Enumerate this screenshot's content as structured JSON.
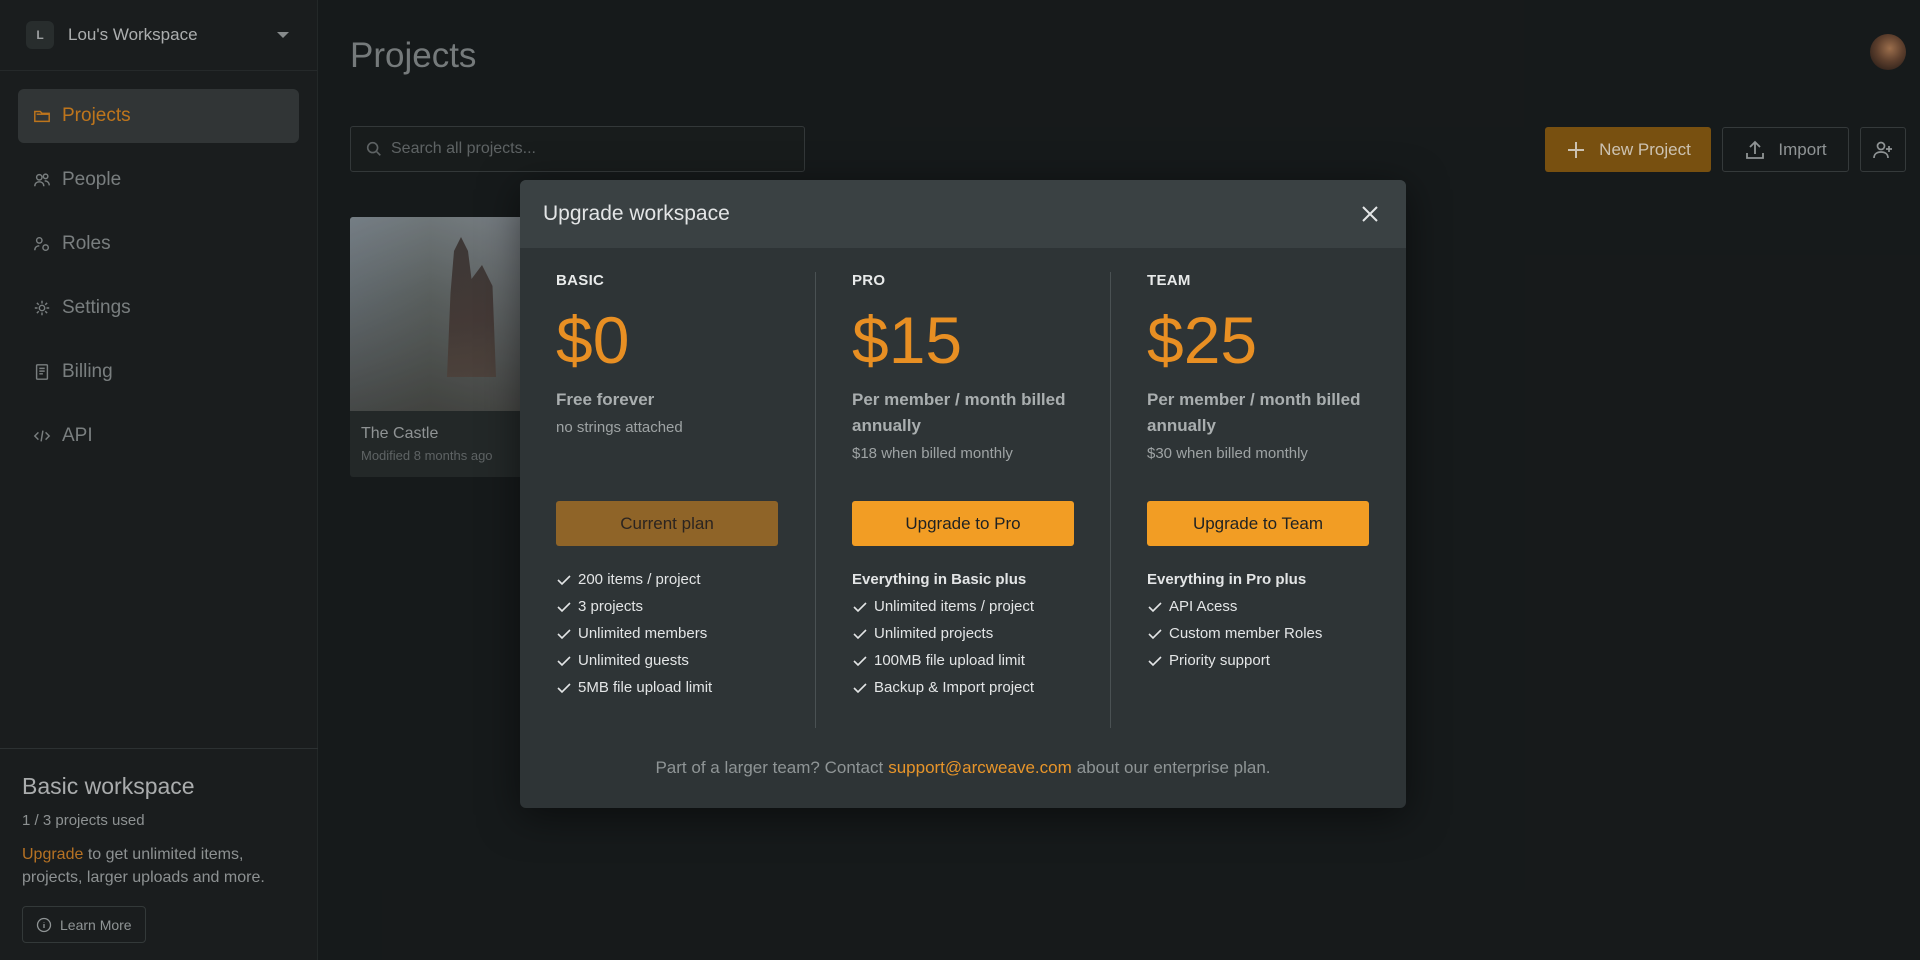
{
  "sidebar": {
    "workspace": {
      "initial": "L",
      "name": "Lou's Workspace"
    },
    "items": [
      {
        "label": "Projects",
        "icon": "folder-icon",
        "active": true
      },
      {
        "label": "People",
        "icon": "people-icon"
      },
      {
        "label": "Roles",
        "icon": "role-icon"
      },
      {
        "label": "Settings",
        "icon": "gear-icon"
      },
      {
        "label": "Billing",
        "icon": "receipt-icon"
      },
      {
        "label": "API",
        "icon": "code-icon"
      }
    ],
    "footer": {
      "title": "Basic workspace",
      "usage": "1 / 3 projects used",
      "upgrade_link": "Upgrade",
      "upgrade_text": " to get unlimited items, projects, larger uploads and more.",
      "learn_more": "Learn More"
    }
  },
  "main": {
    "title": "Projects",
    "search_placeholder": "Search all projects...",
    "new_project": "New Project",
    "import": "Import",
    "projects": [
      {
        "name": "The Castle",
        "modified": "Modified 8 months ago"
      }
    ]
  },
  "modal": {
    "title": "Upgrade workspace",
    "plans": [
      {
        "tier": "BASIC",
        "price": "$0",
        "desc": "Free forever",
        "sub": "no strings attached",
        "button": "Current plan",
        "features": [
          "200 items / project",
          "3 projects",
          "Unlimited members",
          "Unlimited guests",
          "5MB file upload limit"
        ]
      },
      {
        "tier": "PRO",
        "price": "$15",
        "desc": "Per member / month billed annually",
        "sub": "$18 when billed monthly",
        "button": "Upgrade to Pro",
        "features_head": "Everything in Basic plus",
        "features": [
          "Unlimited items / project",
          "Unlimited projects",
          "100MB file upload limit",
          "Backup & Import project"
        ]
      },
      {
        "tier": "TEAM",
        "price": "$25",
        "desc": "Per member / month billed annually",
        "sub": "$30 when billed monthly",
        "button": "Upgrade to Team",
        "features_head": "Everything in Pro plus",
        "features": [
          "API Acess",
          "Custom member Roles",
          "Priority support"
        ]
      }
    ],
    "footer": {
      "before": "Part of a larger team? Contact",
      "email": "support@arcweave.com",
      "after": "about our enterprise plan."
    }
  },
  "colors": {
    "accent": "#e88f23",
    "button_accent": "#f29d24",
    "current_plan": "#8f6428"
  }
}
